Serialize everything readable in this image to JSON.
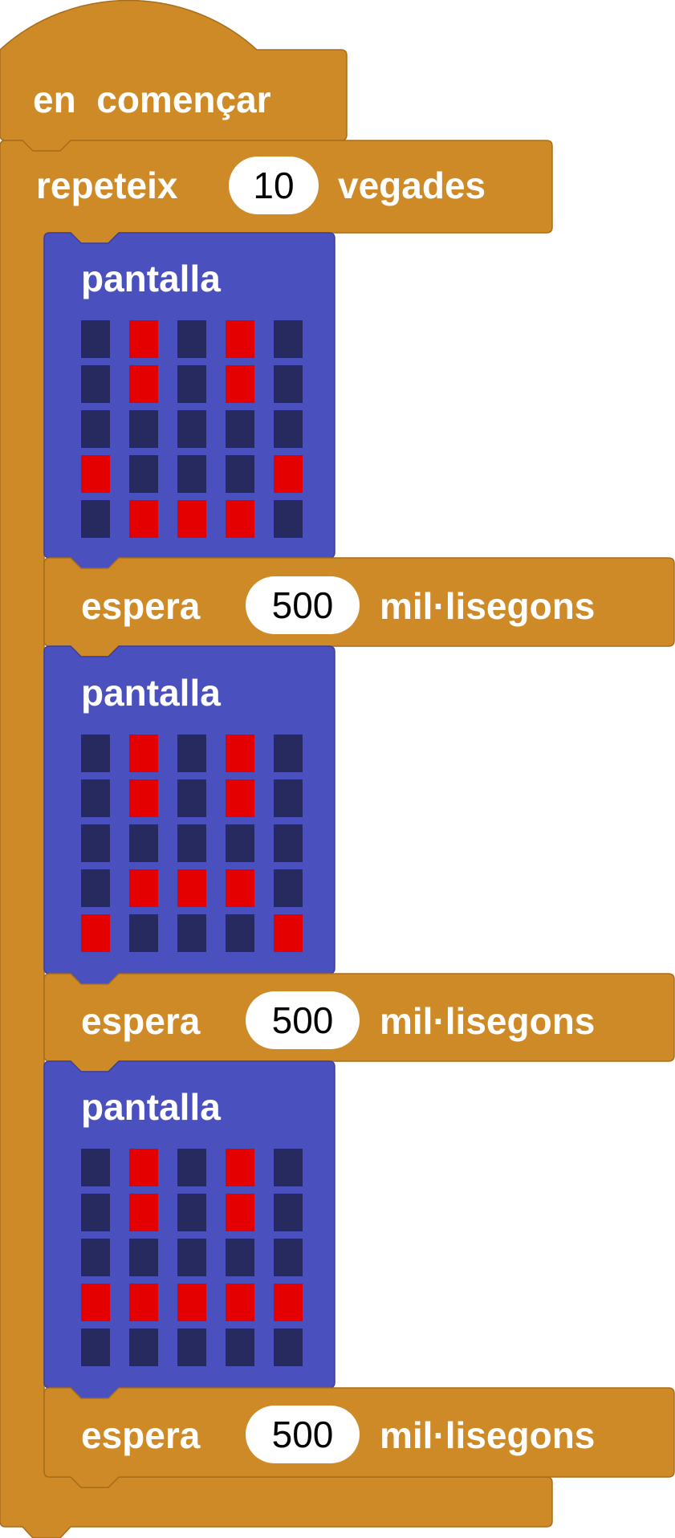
{
  "colors": {
    "control": "#CF8A28",
    "control_border": "#A86D1A",
    "display": "#4A51BE",
    "display_border": "#3A3F9A",
    "led_on": "#E40000",
    "led_off": "#262A5E"
  },
  "start_block": {
    "label": "en  començar"
  },
  "repeat_block": {
    "keyword": "repeteix",
    "count": "10",
    "unit": "vegades"
  },
  "display_blocks": [
    {
      "label": "pantalla",
      "leds": [
        [
          0,
          1,
          0,
          1,
          0
        ],
        [
          0,
          1,
          0,
          1,
          0
        ],
        [
          0,
          0,
          0,
          0,
          0
        ],
        [
          1,
          0,
          0,
          0,
          1
        ],
        [
          0,
          1,
          1,
          1,
          0
        ]
      ]
    },
    {
      "label": "pantalla",
      "leds": [
        [
          0,
          1,
          0,
          1,
          0
        ],
        [
          0,
          1,
          0,
          1,
          0
        ],
        [
          0,
          0,
          0,
          0,
          0
        ],
        [
          0,
          1,
          1,
          1,
          0
        ],
        [
          1,
          0,
          0,
          0,
          1
        ]
      ]
    },
    {
      "label": "pantalla",
      "leds": [
        [
          0,
          1,
          0,
          1,
          0
        ],
        [
          0,
          1,
          0,
          1,
          0
        ],
        [
          0,
          0,
          0,
          0,
          0
        ],
        [
          1,
          1,
          1,
          1,
          1
        ],
        [
          0,
          0,
          0,
          0,
          0
        ]
      ]
    }
  ],
  "wait_blocks": [
    {
      "keyword": "espera",
      "value": "500",
      "unit": "mil·lisegons"
    },
    {
      "keyword": "espera",
      "value": "500",
      "unit": "mil·lisegons"
    },
    {
      "keyword": "espera",
      "value": "500",
      "unit": "mil·lisegons"
    }
  ]
}
